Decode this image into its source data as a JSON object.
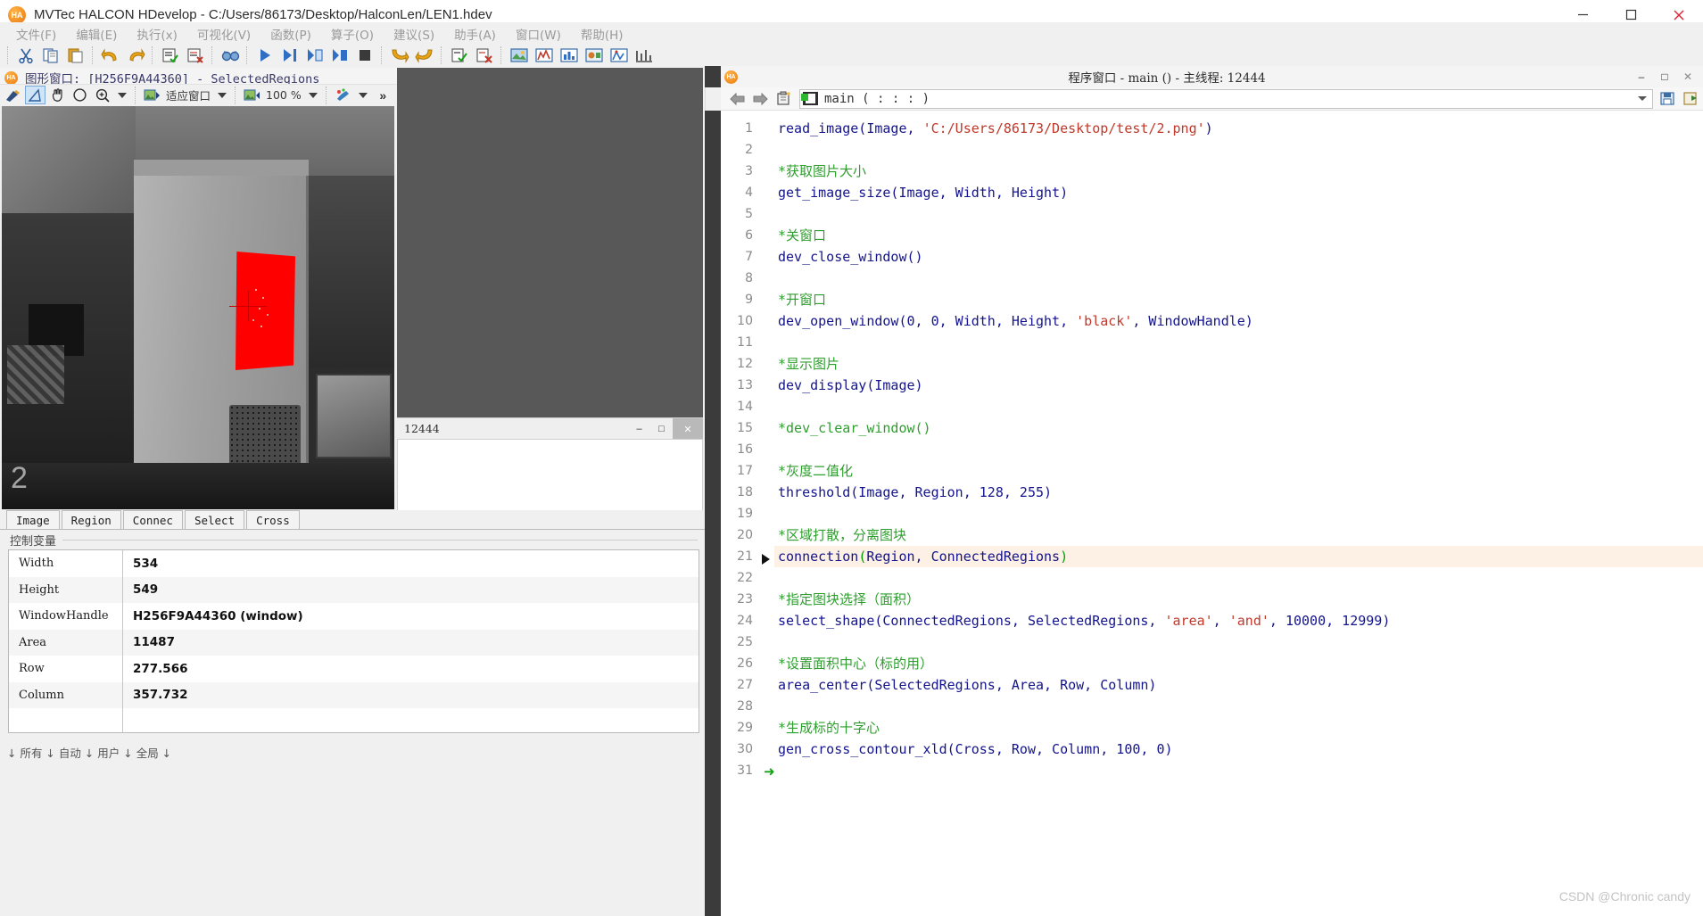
{
  "window": {
    "title": "MVTec HALCON HDevelop - C:/Users/86173/Desktop/HalconLen/LEN1.hdev",
    "logo_text": "HA",
    "minimize": "─",
    "maximize": "□",
    "close": "✕"
  },
  "menubar": {
    "items": [
      {
        "label": "文件(F)"
      },
      {
        "label": "编辑(E)"
      },
      {
        "label": "执行(x)"
      },
      {
        "label": "可视化(V)"
      },
      {
        "label": "函数(P)"
      },
      {
        "label": "算子(O)"
      },
      {
        "label": "建议(S)"
      },
      {
        "label": "助手(A)"
      },
      {
        "label": "窗口(W)"
      },
      {
        "label": "帮助(H)"
      }
    ]
  },
  "toolbar": {
    "icons": [
      "cut-icon",
      "copy-icon",
      "paste-icon",
      "undo-icon",
      "redo-icon",
      "comment-icon",
      "uncomment-icon",
      "find-icon",
      "run-icon",
      "step-over-icon",
      "step-into-icon",
      "step-out-icon",
      "stop-icon",
      "continue-icon",
      "reset-icon",
      "activate-icon",
      "deactivate-icon",
      "image-variables-icon",
      "gray-histogram-icon",
      "feature-histogram-icon",
      "region-features-icon",
      "gray-features-icon",
      "measure-icon"
    ]
  },
  "graphics_window": {
    "logo_text": "HA",
    "title": "图形窗口: [H256F9A44360] - SelectedRegions",
    "minimize": "–",
    "maximize": "□",
    "close": "✕",
    "toolbar": {
      "draw_mode_icon": "draw-region-icon",
      "zoom_select_icon": "magic-wand-icon",
      "pan_icon": "pan-hand-icon",
      "circle_icon": "circle-roi-icon",
      "zoom_icon": "zoom-plus-icon",
      "fit_label": "适应窗口",
      "zoom_level": "100 %",
      "percent_icon": "zoom-level-icon",
      "paint_icon": "color-brush-icon",
      "overflow_label": "»",
      "settings_icon": "gear-icon"
    },
    "image_label": "2"
  },
  "middle_window": {
    "title": "12444",
    "minimize": "–",
    "maximize": "□",
    "close": "✕"
  },
  "variables": {
    "tabs": [
      {
        "label": "Image"
      },
      {
        "label": "Region"
      },
      {
        "label": "Connec"
      },
      {
        "label": "Select"
      },
      {
        "label": "Cross"
      }
    ],
    "section_title": "控制变量",
    "rows": [
      {
        "name": "Width",
        "value": "534"
      },
      {
        "name": "Height",
        "value": "549"
      },
      {
        "name": "WindowHandle",
        "value": "H256F9A44360 (window)"
      },
      {
        "name": "Area",
        "value": "11487"
      },
      {
        "name": "Row",
        "value": "277.566"
      },
      {
        "name": "Column",
        "value": "357.732"
      }
    ],
    "status_strip": "↓ 所有 ↓ 自动 ↓ 用户 ↓ 全局 ↓"
  },
  "program_window": {
    "logo_text": "HA",
    "title": "程序窗口 - main () - 主线程: 12444",
    "minimize": "–",
    "maximize": "□",
    "close": "✕",
    "toolbar": {
      "back_icon": "arrow-left-icon",
      "forward_icon": "arrow-right-icon",
      "new_proc_icon": "new-procedure-icon",
      "procedure_signature": "main ( : : : )",
      "proc_icon": "procedure-icon",
      "caret_icon": "chevron-down-icon",
      "save_icon": "save-procedure-icon",
      "export_icon": "export-procedure-icon"
    }
  },
  "editor": {
    "highlight_line": 21,
    "pc_line": 21,
    "lines": [
      {
        "n": 1,
        "type": "code",
        "text": "read_image(Image, 'C:/Users/86173/Desktop/test/2.png')"
      },
      {
        "n": 2,
        "type": "blank",
        "text": ""
      },
      {
        "n": 3,
        "type": "comment",
        "text": "*获取图片大小"
      },
      {
        "n": 4,
        "type": "code",
        "text": "get_image_size(Image, Width, Height)"
      },
      {
        "n": 5,
        "type": "blank",
        "text": ""
      },
      {
        "n": 6,
        "type": "comment",
        "text": "*关窗口"
      },
      {
        "n": 7,
        "type": "code",
        "text": "dev_close_window()"
      },
      {
        "n": 8,
        "type": "blank",
        "text": ""
      },
      {
        "n": 9,
        "type": "comment",
        "text": "*开窗口"
      },
      {
        "n": 10,
        "type": "code",
        "text": "dev_open_window(0, 0, Width, Height, 'black', WindowHandle)"
      },
      {
        "n": 11,
        "type": "blank",
        "text": ""
      },
      {
        "n": 12,
        "type": "comment",
        "text": "*显示图片"
      },
      {
        "n": 13,
        "type": "code",
        "text": "dev_display(Image)"
      },
      {
        "n": 14,
        "type": "blank",
        "text": ""
      },
      {
        "n": 15,
        "type": "comment",
        "text": "*dev_clear_window()"
      },
      {
        "n": 16,
        "type": "blank",
        "text": ""
      },
      {
        "n": 17,
        "type": "comment",
        "text": "*灰度二值化"
      },
      {
        "n": 18,
        "type": "code",
        "text": "threshold(Image, Region, 128, 255)"
      },
      {
        "n": 19,
        "type": "blank",
        "text": ""
      },
      {
        "n": 20,
        "type": "comment",
        "text": "*区域打散，分离图块"
      },
      {
        "n": 21,
        "type": "code",
        "text": "connection(Region, ConnectedRegions)"
      },
      {
        "n": 22,
        "type": "blank",
        "text": ""
      },
      {
        "n": 23,
        "type": "comment",
        "text": "*指定图块选择（面积）"
      },
      {
        "n": 24,
        "type": "code",
        "text": "select_shape(ConnectedRegions, SelectedRegions, 'area', 'and', 10000, 12999)"
      },
      {
        "n": 25,
        "type": "blank",
        "text": ""
      },
      {
        "n": 26,
        "type": "comment",
        "text": "*设置面积中心（标的用）"
      },
      {
        "n": 27,
        "type": "code",
        "text": "area_center(SelectedRegions, Area, Row, Column)"
      },
      {
        "n": 28,
        "type": "blank",
        "text": ""
      },
      {
        "n": 29,
        "type": "comment",
        "text": "*生成标的十字心"
      },
      {
        "n": 30,
        "type": "code",
        "text": "gen_cross_contour_xld(Cross, Row, Column, 100, 0)"
      },
      {
        "n": 31,
        "type": "blank",
        "text": ""
      }
    ],
    "pc_arrow_glyph": "➜"
  },
  "watermark": "CSDN @Chronic candy",
  "colors": {
    "accent_orange": "#f08a1e",
    "region_red": "#ff0000",
    "keyword_blue": "#14148c",
    "comment_green": "#2e9e2e",
    "string_red": "#c0392b",
    "highlight_bg": "#fdf0e4"
  }
}
